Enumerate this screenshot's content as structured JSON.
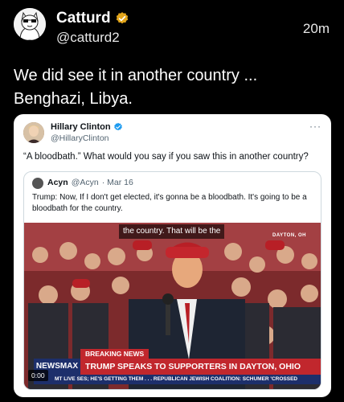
{
  "post": {
    "author_name": "Catturd",
    "author_handle": "@catturd2",
    "time": "20m",
    "text": "We did see it in another country ...\nBenghazi, Libya."
  },
  "quoted_post": {
    "author_name": "Hillary Clinton",
    "author_handle": "@HillaryClinton",
    "more": "···",
    "text": "“A bloodbath.” What would you say if you saw this in another country?"
  },
  "nested_quote": {
    "author_name": "Acyn",
    "author_handle": "@Acyn",
    "date": "· Mar 16",
    "text": "Trump: Now, If I don't get elected, it's gonna be a bloodbath. It's going to be a bloodbath for the country."
  },
  "video": {
    "caption": "the country. That will be the",
    "location_tag": "DAYTON, OH",
    "breaking_label": "BREAKING NEWS",
    "network": "NEWSMAX",
    "headline": "TRUMP SPEAKS TO SUPPORTERS IN DAYTON, OHIO",
    "ticker": "MT  LIVE  SES; HE'S GETTING THEM . . .    REPUBLICAN JEWISH COALITION: SCHUMER 'CROSSED",
    "timestamp": "0:00"
  },
  "colors": {
    "background": "#000000",
    "verified_gold": "#e2a51b",
    "verified_blue": "#1d9bf0",
    "news_red": "#c1272d",
    "news_navy": "#1d2f6b"
  }
}
